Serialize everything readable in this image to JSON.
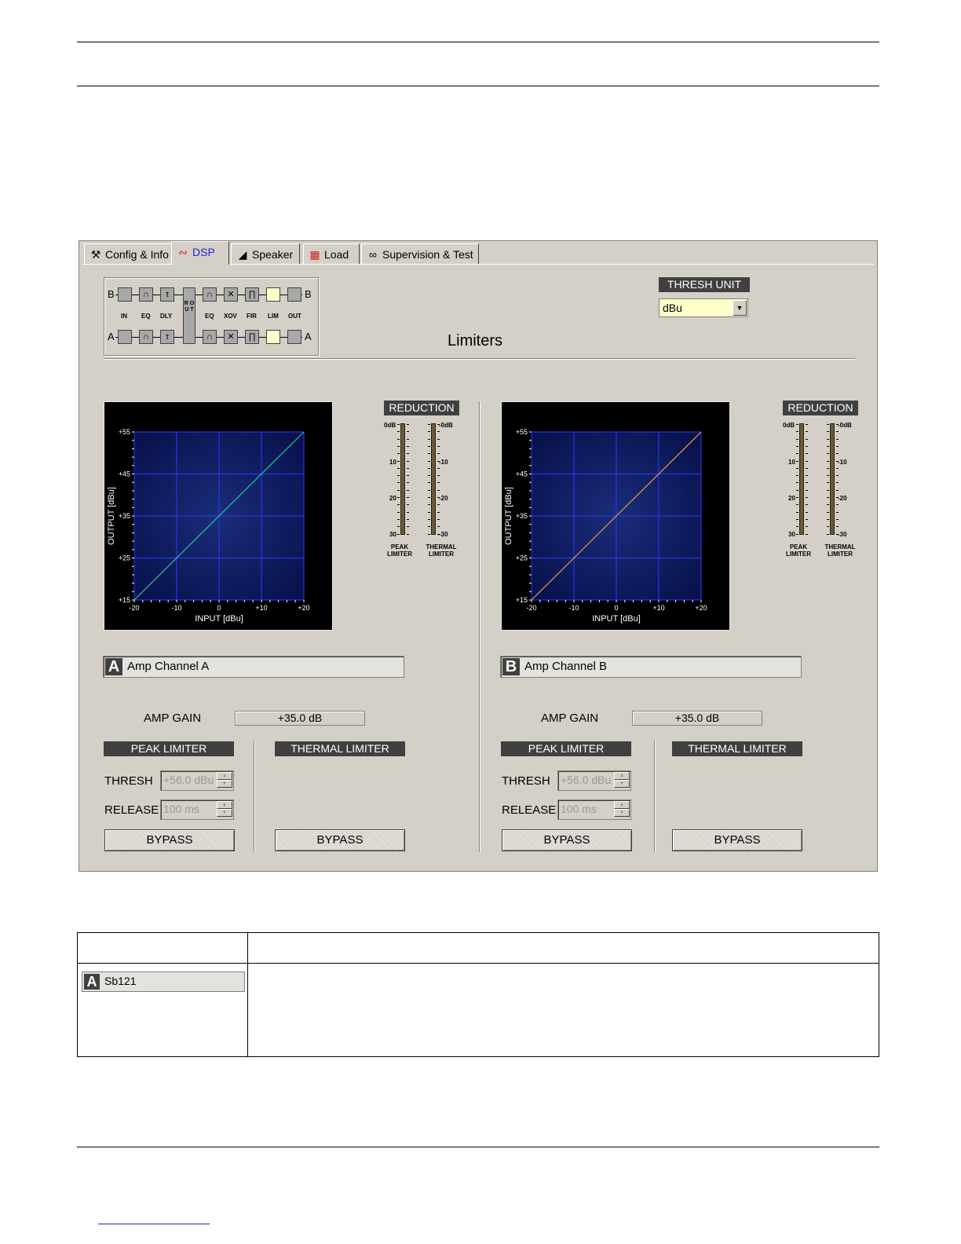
{
  "tabs": [
    {
      "label": "Config & Info",
      "icon": "hammer-icon"
    },
    {
      "label": "DSP",
      "icon": "dsp-curve-icon"
    },
    {
      "label": "Speaker",
      "icon": "speaker-icon"
    },
    {
      "label": "Load",
      "icon": "load-icon"
    },
    {
      "label": "Supervision & Test",
      "icon": "glasses-icon"
    }
  ],
  "chain": {
    "top_channel": "B",
    "bottom_channel": "A",
    "out_top": "B",
    "out_bottom": "A",
    "labels": [
      "IN",
      "EQ",
      "DLY",
      "EQ",
      "XOV",
      "FIR",
      "LIM",
      "OUT"
    ],
    "rout": "R O U T"
  },
  "thresh_unit": {
    "label": "THRESH UNIT",
    "value": "dBu"
  },
  "page_title": "Limiters",
  "channels": [
    {
      "letter": "A",
      "name": "Amp Channel A",
      "graph": {
        "ylabel": "OUTPUT [dBu]",
        "xlabel": "INPUT [dBu]",
        "yticks": [
          "+55",
          "+45",
          "+35",
          "+25",
          "+15"
        ],
        "xticks": [
          "-20",
          "-10",
          "0",
          "+10",
          "+20"
        ],
        "line_color": "#22c88c"
      },
      "reduction": {
        "label": "REDUCTION",
        "peak_scale": [
          "0dB",
          "10",
          "20",
          "30"
        ],
        "thermal_scale": [
          "0dB",
          "10",
          "20",
          "30"
        ],
        "peak_name": "PEAK LIMITER",
        "thermal_name": "THERMAL LIMITER"
      },
      "amp_gain_label": "AMP GAIN",
      "amp_gain": "+35.0 dB",
      "peak_label": "PEAK LIMITER",
      "thermal_label": "THERMAL LIMITER",
      "thresh_label": "THRESH",
      "thresh_value": "+56.0 dBu",
      "release_label": "RELEASE",
      "release_value": "100 ms",
      "bypass": "BYPASS"
    },
    {
      "letter": "B",
      "name": "Amp Channel B",
      "graph": {
        "ylabel": "OUTPUT [dBu]",
        "xlabel": "INPUT [dBu]",
        "yticks": [
          "+55",
          "+45",
          "+35",
          "+25",
          "+15"
        ],
        "xticks": [
          "-20",
          "-10",
          "0",
          "+10",
          "+20"
        ],
        "line_color": "#e0a040"
      },
      "reduction": {
        "label": "REDUCTION",
        "peak_scale": [
          "0dB",
          "10",
          "20",
          "30"
        ],
        "thermal_scale": [
          "0dB",
          "10",
          "20",
          "30"
        ],
        "peak_name": "PEAK LIMITER",
        "thermal_name": "THERMAL LIMITER"
      },
      "amp_gain_label": "AMP GAIN",
      "amp_gain": "+35.0 dB",
      "peak_label": "PEAK LIMITER",
      "thermal_label": "THERMAL LIMITER",
      "thresh_label": "THRESH",
      "thresh_value": "+56.0 dBu",
      "release_label": "RELEASE",
      "release_value": "100 ms",
      "bypass": "BYPASS"
    }
  ],
  "table": {
    "letter": "A",
    "name": "Sb121"
  }
}
